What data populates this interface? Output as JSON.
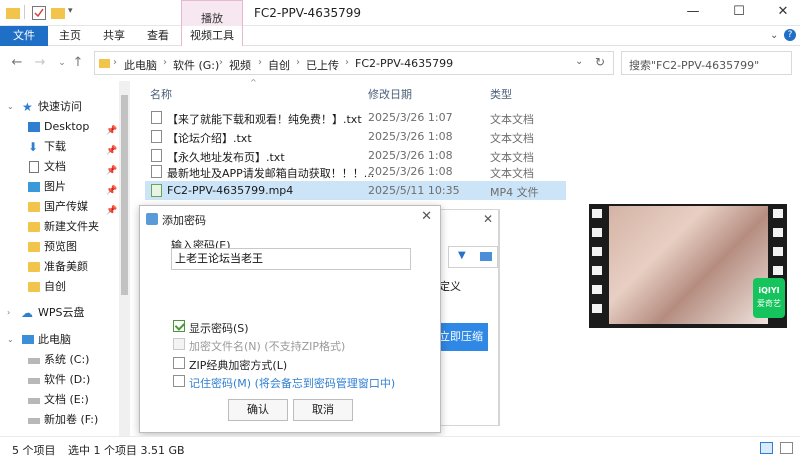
{
  "window": {
    "title": "FC2-PPV-4635799",
    "context_tab_group": "播放",
    "controls": {
      "minimize": "—",
      "maximize": "☐",
      "close": "✕"
    }
  },
  "ribbon": {
    "tabs": [
      {
        "label": "文件",
        "active": true
      },
      {
        "label": "主页"
      },
      {
        "label": "共享"
      },
      {
        "label": "查看"
      },
      {
        "label": "视频工具"
      }
    ]
  },
  "address": {
    "crumbs": [
      "此电脑",
      "软件 (G:)",
      "视频",
      "自创",
      "已上传",
      "FC2-PPV-4635799"
    ]
  },
  "search": {
    "placeholder": "搜索\"FC2-PPV-4635799\""
  },
  "sidebar": {
    "items": [
      {
        "label": "快速访问",
        "icon": "star-icon"
      },
      {
        "label": "Desktop",
        "icon": "desktop-icon",
        "pinned": true
      },
      {
        "label": "下载",
        "icon": "download-icon",
        "pinned": true
      },
      {
        "label": "文档",
        "icon": "document-icon",
        "pinned": true
      },
      {
        "label": "图片",
        "icon": "picture-icon",
        "pinned": true
      },
      {
        "label": "国产传媒",
        "icon": "folder-icon",
        "pinned": true
      },
      {
        "label": "新建文件夹",
        "icon": "folder-icon"
      },
      {
        "label": "预览图",
        "icon": "folder-icon"
      },
      {
        "label": "准备美颜",
        "icon": "folder-icon"
      },
      {
        "label": "自创",
        "icon": "folder-icon"
      },
      {
        "label": "WPS云盘",
        "icon": "cloud-icon"
      },
      {
        "label": "此电脑",
        "icon": "computer-icon"
      },
      {
        "label": "系统 (C:)",
        "icon": "drive-icon"
      },
      {
        "label": "软件 (D:)",
        "icon": "drive-icon"
      },
      {
        "label": "文档 (E:)",
        "icon": "drive-icon"
      },
      {
        "label": "新加卷 (F:)",
        "icon": "drive-icon"
      }
    ]
  },
  "columns": {
    "name": "名称",
    "date": "修改日期",
    "type": "类型"
  },
  "files": [
    {
      "name": "【来了就能下载和观看！纯免费！】.txt",
      "date": "2025/3/26 1:07",
      "type": "文本文档"
    },
    {
      "name": "【论坛介绍】.txt",
      "date": "2025/3/26 1:08",
      "type": "文本文档"
    },
    {
      "name": "【永久地址发布页】.txt",
      "date": "2025/3/26 1:08",
      "type": "文本文档"
    },
    {
      "name": "最新地址及APP请发邮箱自动获取！！！...",
      "date": "2025/3/26 1:08",
      "type": "文本文档"
    },
    {
      "name": "FC2-PPV-4635799.mp4",
      "date": "2025/5/11 10:35",
      "type": "MP4 文件",
      "selected": true
    }
  ],
  "preview": {
    "badge_top": "iQIYI",
    "badge_bottom": "爱奇艺"
  },
  "background_dialog": {
    "partial_text": "定义",
    "compress_button": "立即压缩"
  },
  "dialog": {
    "title": "添加密码",
    "password_label": "输入密码(E)",
    "password_value": "上老王论坛当老王",
    "options": [
      {
        "label": "显示密码(S)",
        "checked": true,
        "enabled": true
      },
      {
        "label": "加密文件名(N) (不支持ZIP格式)",
        "checked": false,
        "enabled": false
      },
      {
        "label": "ZIP经典加密方式(L)",
        "checked": false,
        "enabled": true
      },
      {
        "label": "记住密码(M) (将会备忘到密码管理窗口中)",
        "checked": false,
        "enabled": true
      }
    ],
    "ok_label": "确认",
    "cancel_label": "取消"
  },
  "status": {
    "count": "5 个项目",
    "selection": "选中 1 个项目  3.51 GB"
  },
  "colors": {
    "accent": "#1f6fc6",
    "selection": "#cce4f7",
    "context_tab": "#f7e7f0"
  }
}
